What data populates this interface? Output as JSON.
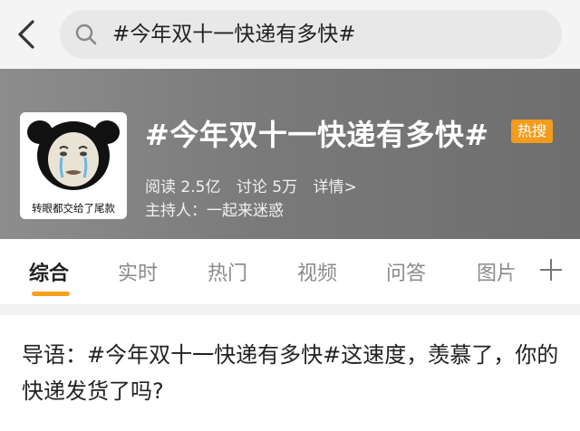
{
  "search": {
    "query": "#今年双十一快递有多快#"
  },
  "hero": {
    "title": "#今年双十一快递有多快#",
    "badge": "热搜",
    "avatar_caption": "转眼都交给了尾款",
    "reads": "阅读 2.5亿",
    "discussions": "讨论 5万",
    "details": "详情>",
    "host": "主持人：一起来迷惑"
  },
  "tabs": [
    {
      "label": "综合",
      "active": true
    },
    {
      "label": "实时"
    },
    {
      "label": "热门"
    },
    {
      "label": "视频"
    },
    {
      "label": "问答"
    },
    {
      "label": "图片"
    }
  ],
  "intro": {
    "text": "导语：#今年双十一快递有多快#这速度，羡慕了，你的快递发货了吗?"
  },
  "colors": {
    "accent": "#f7a21b",
    "badge": "#f39c1f",
    "hero_bg": "#7a7a7a"
  },
  "icons": [
    "back-arrow-icon",
    "search-icon",
    "plus-icon"
  ]
}
